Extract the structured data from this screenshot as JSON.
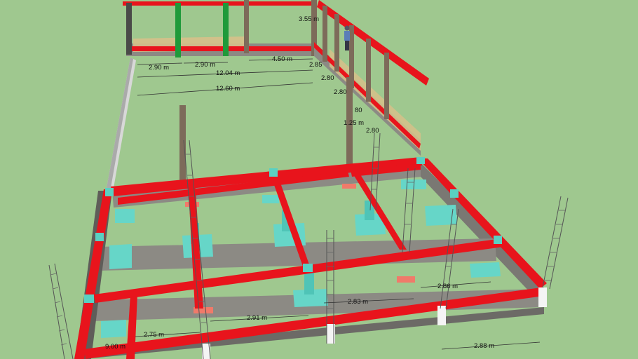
{
  "colors": {
    "background": "#9fc88f",
    "beam": "#e8141c",
    "beam_dark": "#a50d12",
    "block": "#8c8a84",
    "block_dark": "#5f5d59",
    "footing": "#66d6c8",
    "footing_dark": "#3da89b",
    "column": "#7d6b5a",
    "wall_panel": "#d6c08a",
    "green_post": "#1f9a3a",
    "pad_red": "#f07a6a",
    "white_cap": "#f4f4f4"
  },
  "dimensions": {
    "d_290a": "2.90 m",
    "d_290b": "2.90 m",
    "d_450": "4.50 m",
    "d_1204": "12.04 m",
    "d_1260": "12.60 m",
    "d_355": "3.55 m",
    "d_285": "2.85",
    "d_280a": "2.80",
    "d_280b": "2.80",
    "d_80": "80",
    "d_1125": "1.25 m",
    "d_280c": "2.80",
    "d_275": "2.75 m",
    "d_291": "2.91 m",
    "d_283": "2.83 m",
    "d_286": "2.86 m",
    "d_288": "2.88 m",
    "d_900": "9.00 m"
  }
}
